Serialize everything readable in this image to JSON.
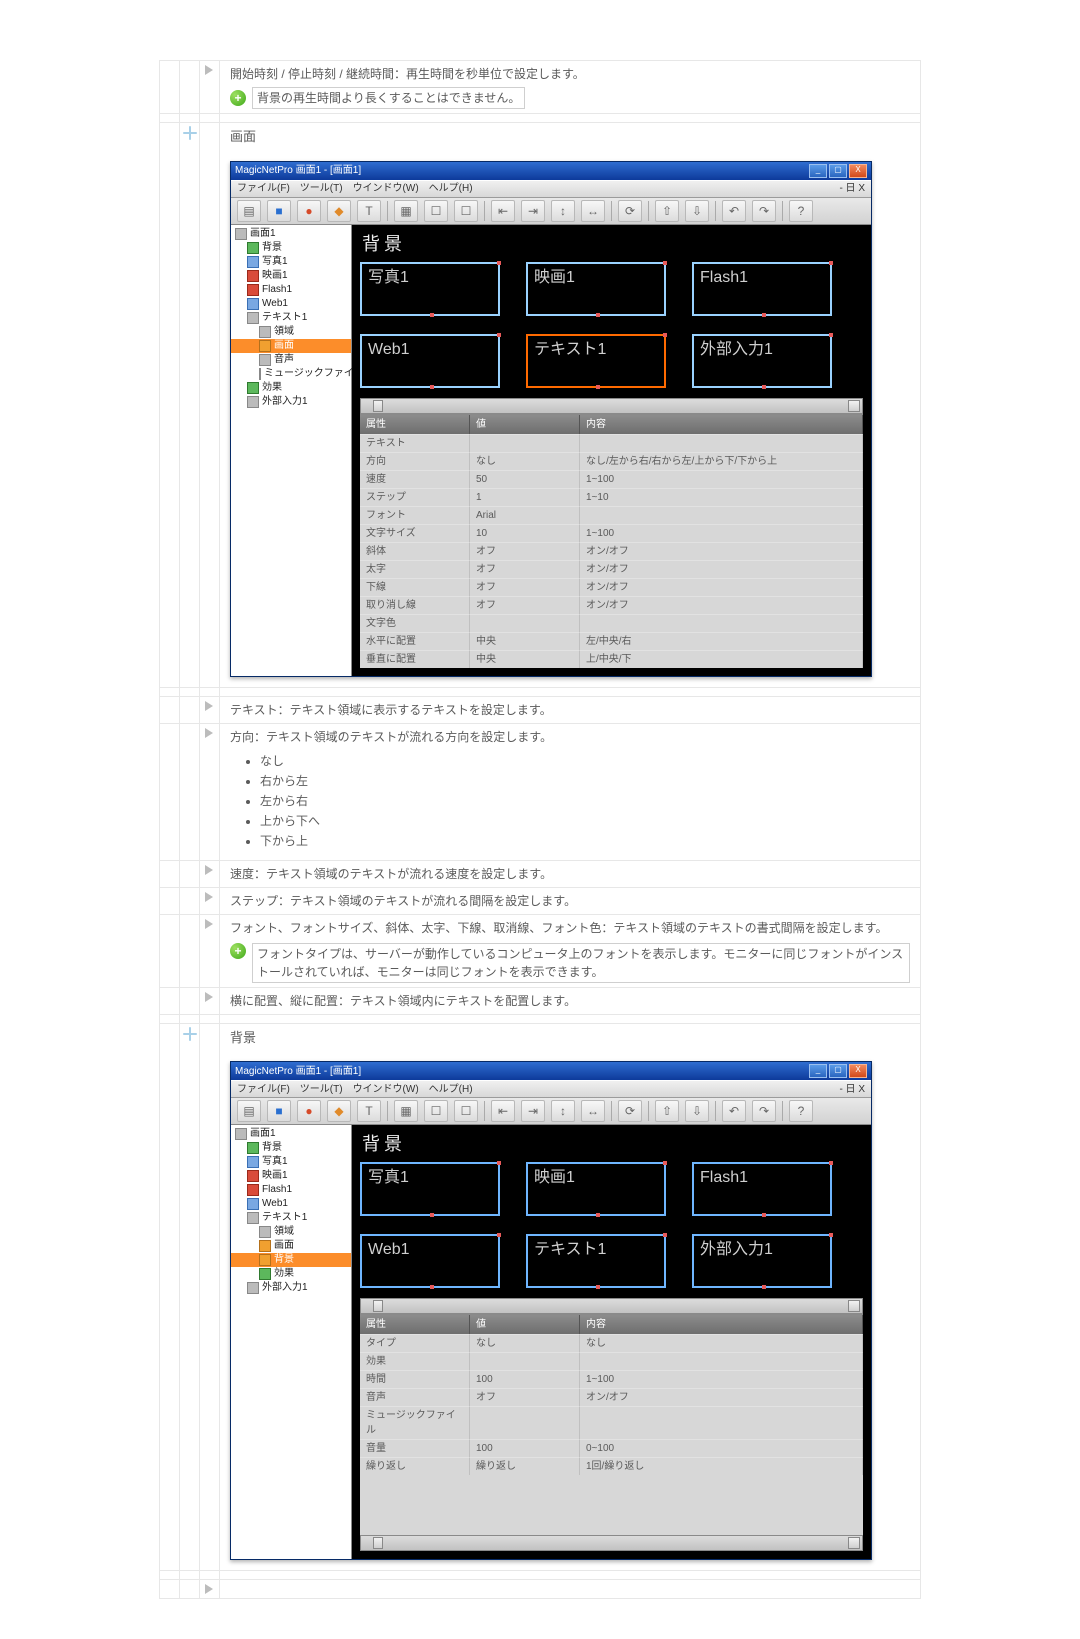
{
  "top": {
    "time_text": "開始時刻 / 停止時刻 / 継続時間：再生時間を秒単位で設定します。",
    "time_note": "背景の再生時間より長くすることはできません。"
  },
  "section_screen": "画面",
  "screenshot1": {
    "title": "MagicNetPro 画面1 - [画面1]",
    "menus": [
      "ファイル(F)",
      "ツール(T)",
      "ウインドウ(W)",
      "ヘルプ(H)"
    ],
    "menu_right": "- 日 X",
    "tree": [
      {
        "l": 1,
        "sel": false,
        "icon": "gray",
        "label": "画面1"
      },
      {
        "l": 2,
        "sel": false,
        "icon": "green",
        "label": "背景"
      },
      {
        "l": 2,
        "sel": false,
        "icon": "blue",
        "label": "写真1"
      },
      {
        "l": 2,
        "sel": false,
        "icon": "red",
        "label": "映画1"
      },
      {
        "l": 2,
        "sel": false,
        "icon": "red",
        "label": "Flash1"
      },
      {
        "l": 2,
        "sel": false,
        "icon": "blue",
        "label": "Web1"
      },
      {
        "l": 2,
        "sel": false,
        "icon": "gray",
        "label": "テキスト1"
      },
      {
        "l": 3,
        "sel": false,
        "icon": "gray",
        "label": "領域"
      },
      {
        "l": 3,
        "sel": true,
        "icon": "orange",
        "label": "画面"
      },
      {
        "l": 3,
        "sel": false,
        "icon": "gray",
        "label": "音声"
      },
      {
        "l": 3,
        "sel": false,
        "icon": "gray",
        "label": "ミュージックファイル"
      },
      {
        "l": 2,
        "sel": false,
        "icon": "green",
        "label": "効果"
      },
      {
        "l": 2,
        "sel": false,
        "icon": "gray",
        "label": "外部入力1"
      }
    ],
    "canvas_header": "背景",
    "tiles_row1": [
      "写真1",
      "映画1",
      "Flash1"
    ],
    "tiles_row2": [
      "Web1",
      "テキスト1",
      "外部入力1"
    ],
    "focus_tile": "テキスト1",
    "prop_cols": [
      "属性",
      "値",
      "内容"
    ],
    "props": [
      {
        "a": "テキスト",
        "v": "",
        "c": ""
      },
      {
        "a": "方向",
        "v": "なし",
        "c": "なし/左から右/右から左/上から下/下から上"
      },
      {
        "a": "速度",
        "v": "50",
        "c": "1~100"
      },
      {
        "a": "ステップ",
        "v": "1",
        "c": "1~10"
      },
      {
        "a": "フォント",
        "v": "Arial",
        "c": ""
      },
      {
        "a": "文字サイズ",
        "v": "10",
        "c": "1~100"
      },
      {
        "a": "斜体",
        "v": "オフ",
        "c": "オン/オフ"
      },
      {
        "a": "太字",
        "v": "オフ",
        "c": "オン/オフ"
      },
      {
        "a": "下線",
        "v": "オフ",
        "c": "オン/オフ"
      },
      {
        "a": "取り消し線",
        "v": "オフ",
        "c": "オン/オフ"
      },
      {
        "a": "文字色",
        "v": "",
        "c": ""
      },
      {
        "a": "水平に配置",
        "v": "中央",
        "c": "左/中央/右"
      },
      {
        "a": "垂直に配置",
        "v": "中央",
        "c": "上/中央/下"
      }
    ]
  },
  "text_desc": "テキスト：テキスト領域に表示するテキストを設定します。",
  "direction_desc": "方向：テキスト領域のテキストが流れる方向を設定します。",
  "directions": [
    "なし",
    "右から左",
    "左から右",
    "上から下へ",
    "下から上"
  ],
  "speed_desc": "速度：テキスト領域のテキストが流れる速度を設定します。",
  "step_desc": "ステップ：テキスト領域のテキストが流れる間隔を設定します。",
  "font_desc": "フォント、フォントサイズ、斜体、太字、下線、取消線、フォント色：テキスト領域のテキストの書式間隔を設定します。",
  "font_note": "フォントタイプは、サーバーが動作しているコンピュータ上のフォントを表示します。モニターに同じフォントがインストールされていれば、モニターは同じフォントを表示できます。",
  "layout_desc": "横に配置、縦に配置：テキスト領域内にテキストを配置します。",
  "section_bg": "背景",
  "screenshot2": {
    "title": "MagicNetPro 画面1 - [画面1]",
    "menus": [
      "ファイル(F)",
      "ツール(T)",
      "ウインドウ(W)",
      "ヘルプ(H)"
    ],
    "menu_right": "- 日 X",
    "tree": [
      {
        "l": 1,
        "sel": false,
        "icon": "gray",
        "label": "画面1"
      },
      {
        "l": 2,
        "sel": false,
        "icon": "green",
        "label": "背景"
      },
      {
        "l": 2,
        "sel": false,
        "icon": "blue",
        "label": "写真1"
      },
      {
        "l": 2,
        "sel": false,
        "icon": "red",
        "label": "映画1"
      },
      {
        "l": 2,
        "sel": false,
        "icon": "red",
        "label": "Flash1"
      },
      {
        "l": 2,
        "sel": false,
        "icon": "blue",
        "label": "Web1"
      },
      {
        "l": 2,
        "sel": false,
        "icon": "gray",
        "label": "テキスト1"
      },
      {
        "l": 3,
        "sel": false,
        "icon": "gray",
        "label": "領域"
      },
      {
        "l": 3,
        "sel": false,
        "icon": "orange",
        "label": "画面"
      },
      {
        "l": 3,
        "sel": true,
        "icon": "orange",
        "label": "背景"
      },
      {
        "l": 3,
        "sel": false,
        "icon": "green",
        "label": "効果"
      },
      {
        "l": 2,
        "sel": false,
        "icon": "gray",
        "label": "外部入力1"
      }
    ],
    "canvas_header": "背景",
    "tiles_row1": [
      "写真1",
      "映画1",
      "Flash1"
    ],
    "tiles_row2": [
      "Web1",
      "テキスト1",
      "外部入力1"
    ],
    "focus_tile": "テキスト1",
    "prop_cols": [
      "属性",
      "値",
      "内容"
    ],
    "props": [
      {
        "a": "タイプ",
        "v": "なし",
        "c": "なし"
      },
      {
        "a": "効果",
        "v": "",
        "c": ""
      },
      {
        "a": "時間",
        "v": "100",
        "c": "1~100"
      },
      {
        "a": "音声",
        "v": "オフ",
        "c": "オン/オフ"
      },
      {
        "a": "ミュージックファイル",
        "v": "",
        "c": ""
      },
      {
        "a": "音量",
        "v": "100",
        "c": "0~100"
      },
      {
        "a": "繰り返し",
        "v": "繰り返し",
        "c": "1回/繰り返し"
      }
    ]
  }
}
